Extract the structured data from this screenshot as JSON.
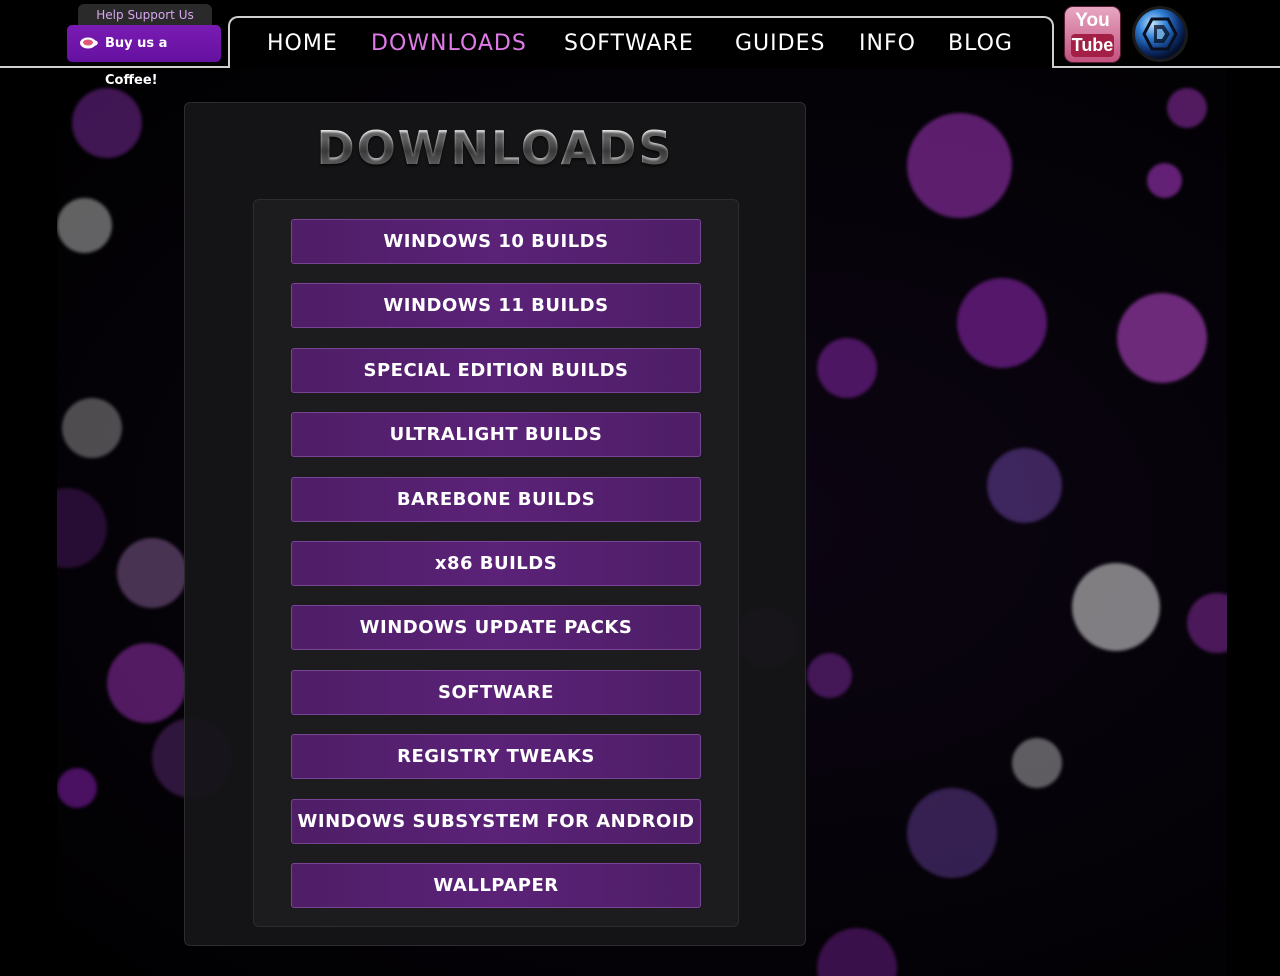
{
  "header": {
    "support_tab": "Help Support Us",
    "coffee_button": "Buy us a Coffee!",
    "nav": [
      {
        "label": "HOME",
        "active": false
      },
      {
        "label": "DOWNLOADS",
        "active": true
      },
      {
        "label": "SOFTWARE",
        "active": false
      },
      {
        "label": "GUIDES",
        "active": false
      },
      {
        "label": "INFO",
        "active": false
      },
      {
        "label": "BLOG",
        "active": false
      }
    ],
    "youtube": {
      "top": "You",
      "bottom": "Tube"
    }
  },
  "main": {
    "title": "DOWNLOADS",
    "buttons": [
      "WINDOWS 10 BUILDS",
      "WINDOWS 11 BUILDS",
      "SPECIAL EDITION BUILDS",
      "ULTRALIGHT BUILDS",
      "BAREBONE BUILDS",
      "x86 BUILDS",
      "WINDOWS UPDATE PACKS",
      "SOFTWARE",
      "REGISTRY TWEAKS",
      "WINDOWS SUBSYSTEM FOR ANDROID",
      "WALLPAPER"
    ]
  },
  "colors": {
    "accent": "#e07ae8",
    "coffee_button": "#6f16aa",
    "button_fill": "#55206f",
    "button_border": "#7a4496",
    "background": "#000000"
  },
  "icons": {
    "coffee": "coffee-cup-icon",
    "youtube": "youtube-logo",
    "site": "site-globe-logo"
  }
}
